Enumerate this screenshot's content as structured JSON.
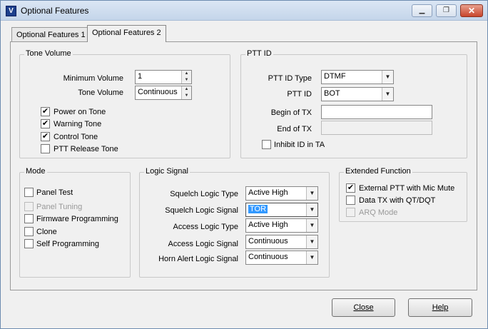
{
  "window": {
    "title": "Optional Features",
    "controls": {
      "minimize": "▁",
      "maximize": "❐",
      "close": "✕"
    }
  },
  "tabs": [
    {
      "label": "Optional Features 1",
      "active": false
    },
    {
      "label": "Optional Features 2",
      "active": true
    }
  ],
  "tone_volume": {
    "title": "Tone Volume",
    "minimum_volume": {
      "label": "Minimum Volume",
      "value": "1"
    },
    "tone_volume": {
      "label": "Tone Volume",
      "value": "Continuous"
    },
    "checks": [
      {
        "label": "Power on Tone",
        "checked": true
      },
      {
        "label": "Warning Tone",
        "checked": true
      },
      {
        "label": "Control Tone",
        "checked": true
      },
      {
        "label": "PTT Release Tone",
        "checked": false
      }
    ]
  },
  "ptt_id": {
    "title": "PTT ID",
    "type": {
      "label": "PTT ID Type",
      "value": "DTMF"
    },
    "id": {
      "label": "PTT ID",
      "value": "BOT"
    },
    "begin": {
      "label": "Begin of TX",
      "value": ""
    },
    "end": {
      "label": "End of TX",
      "value": ""
    },
    "inhibit": {
      "label": "Inhibit ID in TA",
      "checked": false
    }
  },
  "mode": {
    "title": "Mode",
    "checks": [
      {
        "label": "Panel Test",
        "checked": false,
        "enabled": true
      },
      {
        "label": "Panel Tuning",
        "checked": false,
        "enabled": false
      },
      {
        "label": "Firmware Programming",
        "checked": false,
        "enabled": true
      },
      {
        "label": "Clone",
        "checked": false,
        "enabled": true
      },
      {
        "label": "Self Programming",
        "checked": false,
        "enabled": true
      }
    ]
  },
  "logic_signal": {
    "title": "Logic Signal",
    "rows": [
      {
        "label": "Squelch Logic Type",
        "value": "Active High"
      },
      {
        "label": "Squelch Logic Signal",
        "value": "TOR"
      },
      {
        "label": "Access Logic Type",
        "value": "Active High"
      },
      {
        "label": "Access Logic Signal",
        "value": "Continuous"
      },
      {
        "label": "Horn Alert Logic Signal",
        "value": "Continuous"
      }
    ]
  },
  "extended": {
    "title": "Extended Function",
    "checks": [
      {
        "label": "External PTT with Mic Mute",
        "checked": true,
        "enabled": true
      },
      {
        "label": "Data TX with QT/DQT",
        "checked": false,
        "enabled": true
      },
      {
        "label": "ARQ Mode",
        "checked": false,
        "enabled": false
      }
    ]
  },
  "buttons": {
    "close": "Close",
    "help": "Help"
  },
  "icons": {
    "check": "✔",
    "spin_up": "▲",
    "spin_down": "▼",
    "dropdown": "▼"
  },
  "colors": {
    "selection": "#3399ff",
    "title_bar": "#c4d5ea",
    "close_button": "#c8452c"
  }
}
